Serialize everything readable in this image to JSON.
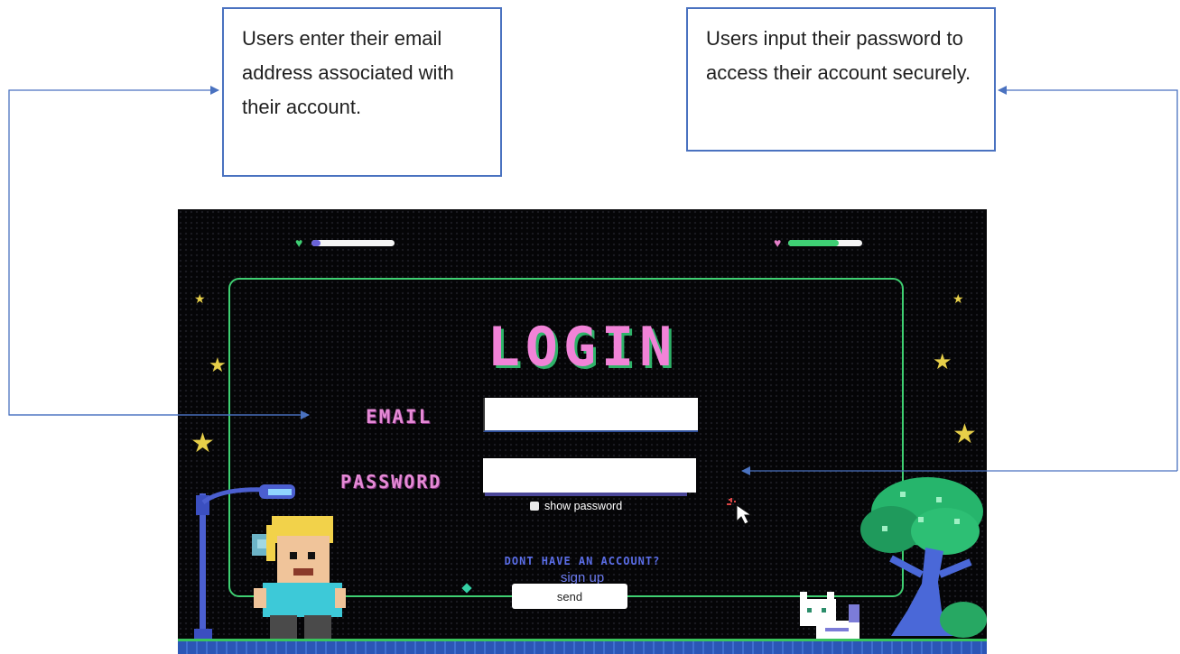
{
  "annotations": {
    "email_callout": "Users enter their email address associated with their account.",
    "password_callout": "Users input their password to access their account securely."
  },
  "login": {
    "title": "LOGIN",
    "email_label": "EMAIL",
    "password_label": "PASSWORD",
    "email_value": "",
    "password_value": "",
    "show_password_label": "show password",
    "no_account_text": "DONT HAVE AN ACCOUNT?",
    "sign_up_label": "sign up",
    "send_label": "send"
  },
  "colors": {
    "title": "#f183d8",
    "title_shadow": "#2fb36a",
    "frame": "#3fcf72",
    "callout_border": "#4a72c0",
    "link": "#6d7cf2",
    "background": "#050507"
  },
  "health_bars": [
    {
      "name": "player-1",
      "fill": 0.0
    },
    {
      "name": "player-2",
      "fill": 0.7
    }
  ],
  "icons": [
    "heart-icon",
    "star-icon",
    "cursor-icon",
    "character-sprite",
    "cat-sprite",
    "tree-sprite",
    "lamppost-sprite"
  ]
}
